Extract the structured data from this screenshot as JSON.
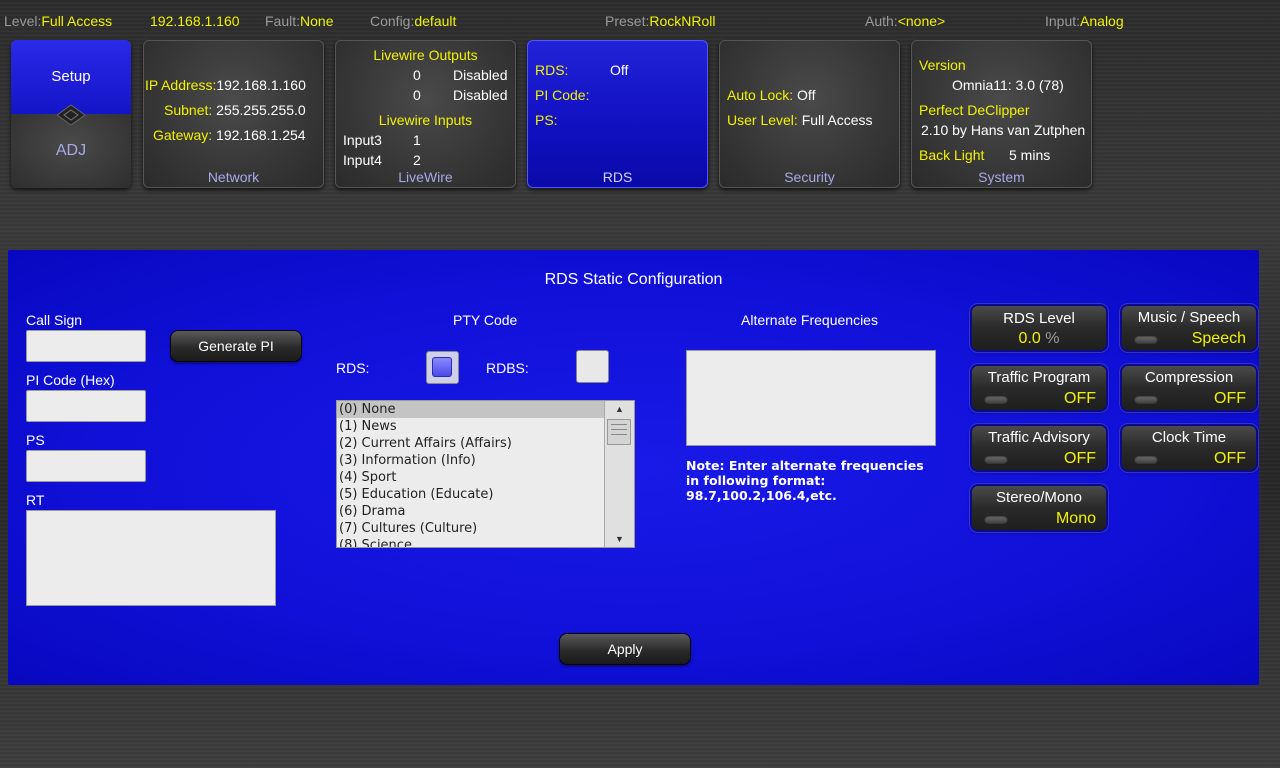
{
  "status": {
    "level_label": "Level:",
    "level_value": "Full Access",
    "ip": "192.168.1.160",
    "fault_label": "Fault:",
    "fault_value": "None",
    "config_label": "Config:",
    "config_value": "default",
    "preset_label": "Preset:",
    "preset_value": "RockNRoll",
    "auth_label": "Auth:",
    "auth_value": "<none>",
    "input_label": "Input:",
    "input_value": "Analog"
  },
  "tiles": {
    "setup": {
      "top": "Setup",
      "bottom": "ADJ"
    },
    "network": {
      "ip_label": "IP Address:",
      "ip_value": "192.168.1.160",
      "subnet_label": "Subnet:",
      "subnet_value": "255.255.255.0",
      "gateway_label": "Gateway:",
      "gateway_value": "192.168.1.254",
      "footer": "Network"
    },
    "livewire": {
      "outputs_title": "Livewire Outputs",
      "out1_num": "0",
      "out1_state": "Disabled",
      "out2_num": "0",
      "out2_state": "Disabled",
      "inputs_title": "Livewire Inputs",
      "in1_name": "Input3",
      "in1_val": "1",
      "in2_name": "Input4",
      "in2_val": "2",
      "footer": "LiveWire"
    },
    "rds": {
      "rds_label": "RDS:",
      "rds_value": "Off",
      "pi_label": "PI Code:",
      "ps_label": "PS:",
      "footer": "RDS"
    },
    "security": {
      "autolock_label": "Auto Lock:",
      "autolock_value": "Off",
      "userlevel_label": "User Level:",
      "userlevel_value": "Full Access",
      "footer": "Security"
    },
    "system": {
      "version_label": "Version",
      "version_value": "Omnia11: 3.0 (78)",
      "declipper_label": "Perfect DeClipper",
      "declipper_value": "2.10 by Hans van Zutphen",
      "backlight_label": "Back Light",
      "backlight_value": "5 mins",
      "footer": "System"
    }
  },
  "panel": {
    "title": "RDS Static Configuration",
    "call_sign_label": "Call Sign",
    "generate_pi": "Generate PI",
    "pi_code_label": "PI Code (Hex)",
    "ps_label": "PS",
    "rt_label": "RT",
    "pty_title": "PTY Code",
    "rds_check_label": "RDS:",
    "rdbs_check_label": "RDBS:",
    "rds_checked": true,
    "rdbs_checked": false,
    "pty_items": [
      "(0) None",
      "(1) News",
      "(2) Current Affairs (Affairs)",
      "(3) Information (Info)",
      "(4) Sport",
      "(5) Education (Educate)",
      "(6) Drama",
      "(7) Cultures (Culture)",
      "(8) Science"
    ],
    "pty_selected_index": 0,
    "af_title": "Alternate Frequencies",
    "af_note_1": "Note: Enter alternate frequencies",
    "af_note_2": "in following format:",
    "af_note_3": "98.7,100.2,106.4,etc.",
    "apply": "Apply"
  },
  "controls": {
    "rds_level": {
      "title": "RDS Level",
      "value": "0.0",
      "unit": "%"
    },
    "music_speech": {
      "title": "Music / Speech",
      "value": "Speech"
    },
    "traffic_program": {
      "title": "Traffic Program",
      "value": "OFF"
    },
    "compression": {
      "title": "Compression",
      "value": "OFF"
    },
    "traffic_advisory": {
      "title": "Traffic Advisory",
      "value": "OFF"
    },
    "clock_time": {
      "title": "Clock Time",
      "value": "OFF"
    },
    "stereo_mono": {
      "title": "Stereo/Mono",
      "value": "Mono"
    }
  },
  "colors": {
    "accent_yellow": "#f2f200",
    "panel_blue": "#1010d8",
    "label_lavender": "#a8a8e8"
  }
}
